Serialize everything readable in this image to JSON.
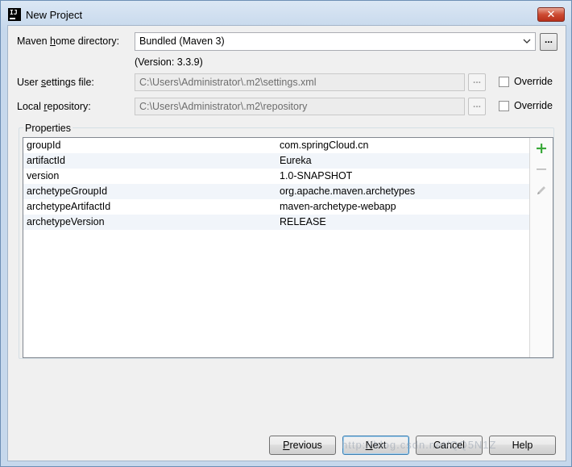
{
  "window": {
    "title": "New Project",
    "app_icon_text": "IJ",
    "close_glyph": "✕"
  },
  "maven_home": {
    "label_pre": "Maven ",
    "label_ul": "h",
    "label_post": "ome directory:",
    "value": "Bundled (Maven 3)",
    "browse_label": "...",
    "version_note": "(Version: 3.3.9)"
  },
  "user_settings": {
    "label_pre": "User ",
    "label_ul": "s",
    "label_post": "ettings file:",
    "value": "C:\\Users\\Administrator\\.m2\\settings.xml",
    "browse_label": "...",
    "override_label": "Override",
    "override_checked": false
  },
  "local_repo": {
    "label_pre": "Local ",
    "label_ul": "r",
    "label_post": "epository:",
    "value": "C:\\Users\\Administrator\\.m2\\repository",
    "browse_label": "...",
    "override_label": "Override",
    "override_checked": false
  },
  "properties": {
    "title": "Properties",
    "rows": [
      {
        "key": "groupId",
        "value": "com.springCloud.cn"
      },
      {
        "key": "artifactId",
        "value": "Eureka"
      },
      {
        "key": "version",
        "value": "1.0-SNAPSHOT"
      },
      {
        "key": "archetypeGroupId",
        "value": "org.apache.maven.archetypes"
      },
      {
        "key": "archetypeArtifactId",
        "value": "maven-archetype-webapp"
      },
      {
        "key": "archetypeVersion",
        "value": "RELEASE"
      }
    ],
    "tools": [
      "plus-icon",
      "minus-icon",
      "pencil-icon"
    ],
    "accent_add": "#3aa83a"
  },
  "buttons": {
    "previous": {
      "ul": "P",
      "rest": "revious"
    },
    "next": {
      "ul": "N",
      "rest": "ext"
    },
    "cancel": {
      "label": "Cancel"
    },
    "help": {
      "label": "Help"
    }
  },
  "watermark": "http://blog.csdn.net/QQ5N1Z"
}
